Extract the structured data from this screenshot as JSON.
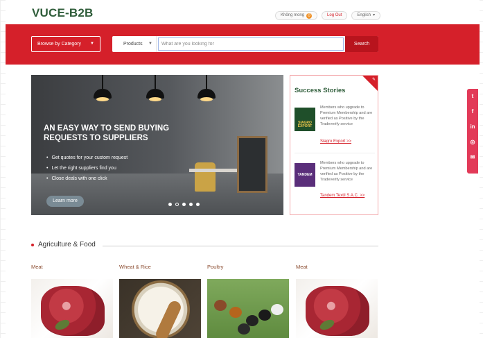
{
  "header": {
    "logo": "VUCE-B2B",
    "user_label": "Không mong",
    "notification_count": "0",
    "logout_label": "Log Out",
    "language_label": "English"
  },
  "searchbar": {
    "browse_label": "Browse by Category",
    "scope_label": "Products",
    "placeholder": "What are you looking for",
    "button_label": "Search"
  },
  "banner": {
    "headline_line1": "AN EASY WAY TO SEND BUYING",
    "headline_line2": "REQUESTS TO SUPPLIERS",
    "bullets": [
      "Get quotes for your custom request",
      "Let the right suppliers find you",
      "Close deals with one click"
    ],
    "cta_label": "Learn more",
    "slides_total": 5,
    "slide_active": 2
  },
  "success_stories": {
    "title": "Success Stories",
    "stories": [
      {
        "logo_text": "SIAGRO EXPORT",
        "text": "Members who upgrade to Premium Membership and are verified as Positive by the Tradeverify service",
        "link": "Siagro Export >>"
      },
      {
        "logo_text": "TANDEM",
        "text": "Members who upgrade to Premium Membership and are verified as Positive by the Tradeverify service",
        "link": "Tandem Textil S.A.C. >>"
      }
    ]
  },
  "social": [
    "twitter-icon",
    "facebook-icon",
    "linkedin-icon",
    "whatsapp-icon",
    "email-icon"
  ],
  "section": {
    "title": "Agriculture & Food",
    "categories": [
      {
        "label": "Meat"
      },
      {
        "label": "Wheat & Rice"
      },
      {
        "label": "Poultry"
      },
      {
        "label": "Meat"
      }
    ]
  },
  "colors": {
    "brand_red": "#d5202a",
    "logo_green": "#2f5d3a"
  }
}
